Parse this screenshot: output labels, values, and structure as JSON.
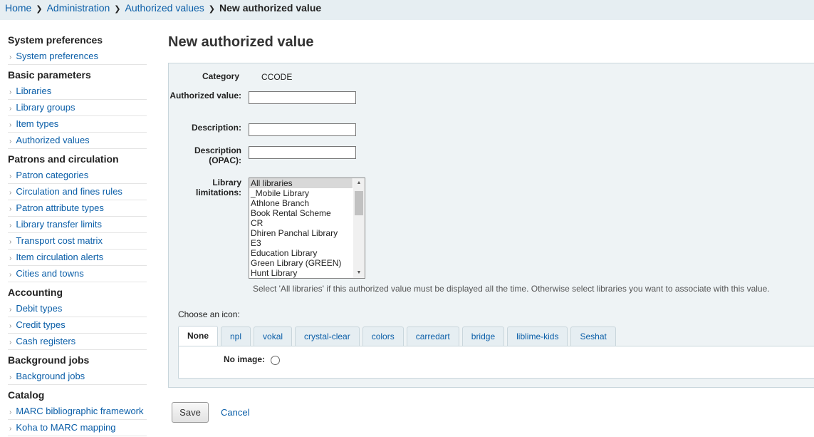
{
  "breadcrumb": {
    "home": "Home",
    "administration": "Administration",
    "authorized_values": "Authorized values",
    "current": "New authorized value"
  },
  "sidebar": {
    "sections": [
      {
        "heading": "System preferences",
        "items": [
          "System preferences"
        ]
      },
      {
        "heading": "Basic parameters",
        "items": [
          "Libraries",
          "Library groups",
          "Item types",
          "Authorized values"
        ]
      },
      {
        "heading": "Patrons and circulation",
        "items": [
          "Patron categories",
          "Circulation and fines rules",
          "Patron attribute types",
          "Library transfer limits",
          "Transport cost matrix",
          "Item circulation alerts",
          "Cities and towns"
        ]
      },
      {
        "heading": "Accounting",
        "items": [
          "Debit types",
          "Credit types",
          "Cash registers"
        ]
      },
      {
        "heading": "Background jobs",
        "items": [
          "Background jobs"
        ]
      },
      {
        "heading": "Catalog",
        "items": [
          "MARC bibliographic framework",
          "Koha to MARC mapping"
        ]
      }
    ]
  },
  "page_title": "New authorized value",
  "form": {
    "category_label": "Category",
    "category_value": "CCODE",
    "authorized_value_label": "Authorized value:",
    "authorized_value_value": "",
    "description_label": "Description:",
    "description_value": "",
    "description_opac_label": "Description (OPAC):",
    "description_opac_value": "",
    "library_limitations_label": "Library limitations:",
    "library_options": [
      "All libraries",
      "_Mobile Library",
      "Athlone Branch",
      "Book Rental Scheme",
      "CR",
      "Dhiren Panchal Library",
      "E3",
      "Education Library",
      "Green Library (GREEN)",
      "Hunt Library"
    ],
    "library_selected": "All libraries",
    "library_hint": "Select 'All libraries' if this authorized value must be displayed all the time. Otherwise select libraries you want to associate with this value.",
    "choose_icon_label": "Choose an icon:",
    "icon_tabs": [
      "None",
      "npl",
      "vokal",
      "crystal-clear",
      "colors",
      "carredart",
      "bridge",
      "liblime-kids",
      "Seshat"
    ],
    "active_tab": "None",
    "no_image_label": "No image:"
  },
  "actions": {
    "save_label": "Save",
    "cancel_label": "Cancel"
  }
}
